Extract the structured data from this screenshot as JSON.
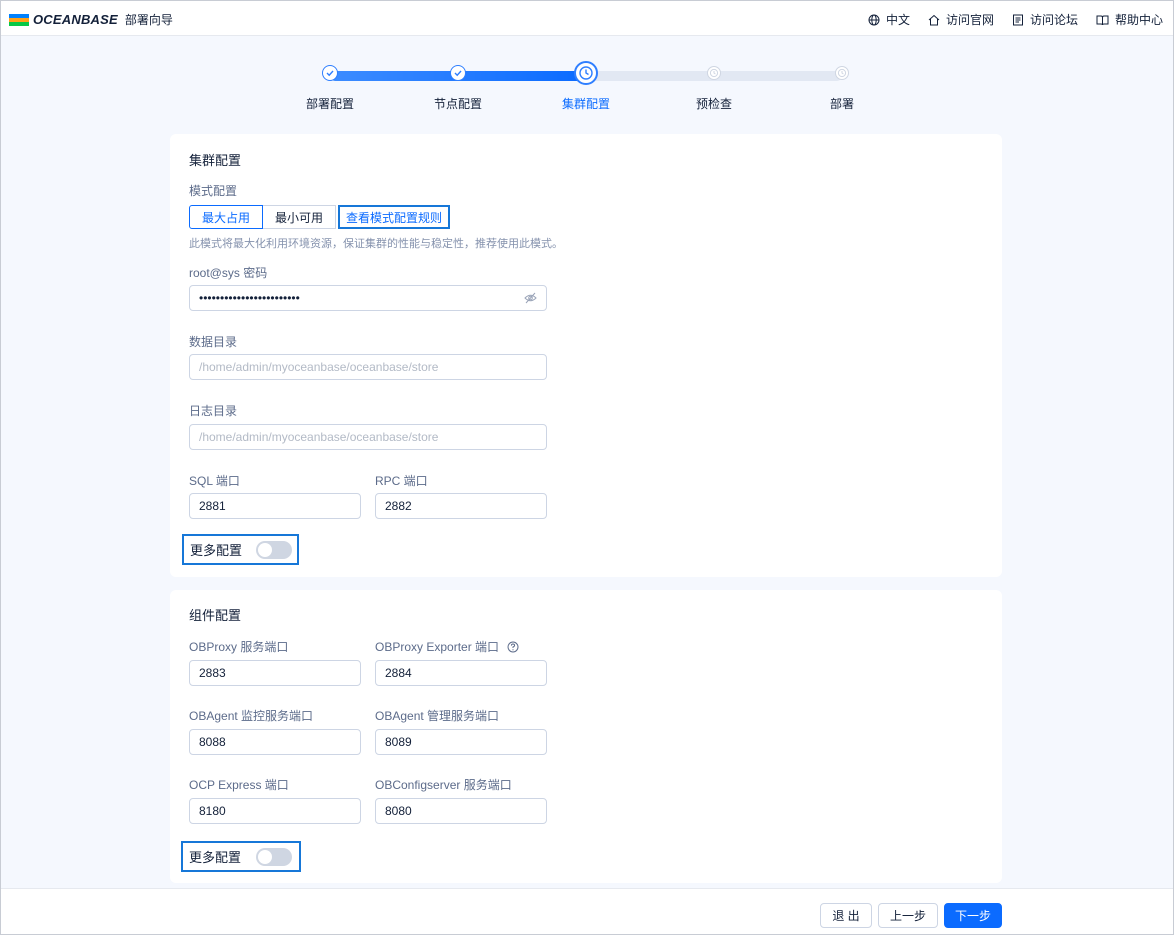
{
  "header": {
    "brand": "OCEANBASE",
    "subtitle": "部署向导",
    "links": [
      {
        "label": "中文",
        "icon": "globe-icon"
      },
      {
        "label": "访问官网",
        "icon": "home-icon"
      },
      {
        "label": "访问论坛",
        "icon": "forum-icon"
      },
      {
        "label": "帮助中心",
        "icon": "book-icon"
      }
    ]
  },
  "steps": [
    {
      "label": "部署配置",
      "status": "done"
    },
    {
      "label": "节点配置",
      "status": "done"
    },
    {
      "label": "集群配置",
      "status": "current"
    },
    {
      "label": "预检查",
      "status": "todo"
    },
    {
      "label": "部署",
      "status": "todo"
    }
  ],
  "cluster": {
    "title": "集群配置",
    "mode_label": "模式配置",
    "mode_max": "最大占用",
    "mode_min": "最小可用",
    "mode_rules_link": "查看模式配置规则",
    "mode_hint": "此模式将最大化利用环境资源，保证集群的性能与稳定性，推荐使用此模式。",
    "password_label": "root@sys 密码",
    "password_value": "••••••••••••••••••••••••",
    "data_dir_label": "数据目录",
    "data_dir_placeholder": "/home/admin/myoceanbase/oceanbase/store",
    "log_dir_label": "日志目录",
    "log_dir_placeholder": "/home/admin/myoceanbase/oceanbase/store",
    "sql_port_label": "SQL 端口",
    "sql_port_value": "2881",
    "rpc_port_label": "RPC 端口",
    "rpc_port_value": "2882",
    "more_config_label": "更多配置",
    "more_config_enabled": false
  },
  "components": {
    "title": "组件配置",
    "obproxy_port_label": "OBProxy 服务端口",
    "obproxy_port_value": "2883",
    "obproxy_exporter_label": "OBProxy Exporter 端口",
    "obproxy_exporter_value": "2884",
    "obagent_monitor_label": "OBAgent 监控服务端口",
    "obagent_monitor_value": "8088",
    "obagent_manage_label": "OBAgent 管理服务端口",
    "obagent_manage_value": "8089",
    "ocp_express_label": "OCP Express 端口",
    "ocp_express_value": "8180",
    "obconfigserver_label": "OBConfigserver 服务端口",
    "obconfigserver_value": "8080",
    "more_config_label": "更多配置",
    "more_config_enabled": false
  },
  "footer": {
    "exit_label": "退 出",
    "prev_label": "上一步",
    "next_label": "下一步"
  },
  "colors": {
    "primary": "#0b6bff",
    "page_bg": "#f5f8fe"
  }
}
